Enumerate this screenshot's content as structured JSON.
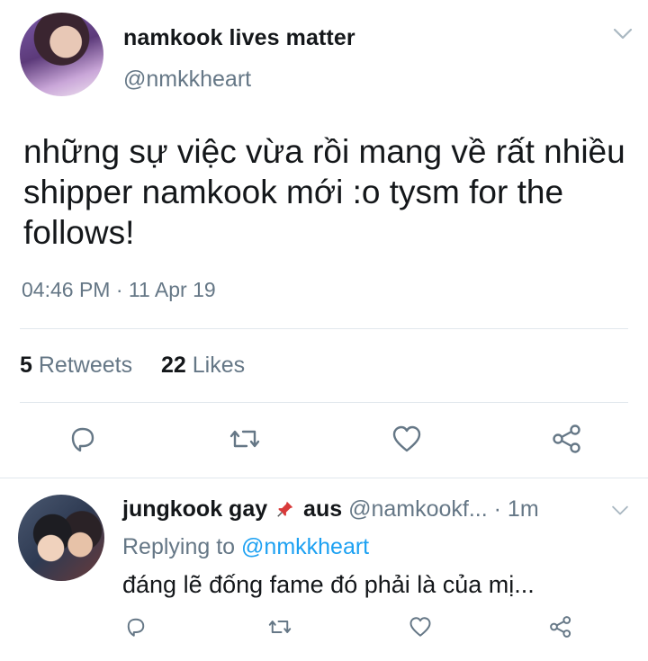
{
  "tweet": {
    "display_name": "namkook lives matter",
    "handle": "@nmkkheart",
    "text": "những sự việc vừa rồi mang về rất nhiều shipper namkook mới :o tysm for the follows!",
    "timestamp": "04:46 PM · 11 Apr 19",
    "retweets_count": "5",
    "retweets_label": "Retweets",
    "likes_count": "22",
    "likes_label": "Likes"
  },
  "actions": [
    "reply-icon",
    "retweet-icon",
    "like-icon",
    "share-icon"
  ],
  "reply": {
    "display_name": "jungkook gay",
    "extra_name": "aus",
    "handle": "@namkookf...",
    "time": "· 1m",
    "replying_prefix": "Replying to",
    "replying_to": "@nmkkheart",
    "text": "đáng lẽ đống fame đó phải là của mị..."
  },
  "colors": {
    "muted": "#657786",
    "link": "#1da1f2",
    "icon": "#657786",
    "divider": "#e1e8ed"
  }
}
